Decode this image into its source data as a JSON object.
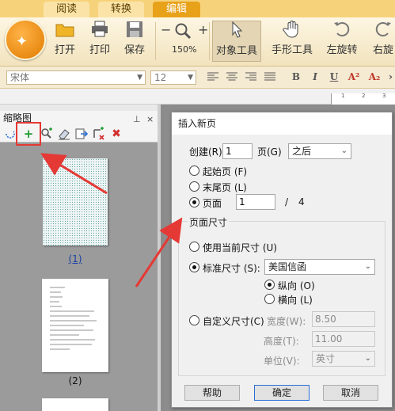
{
  "tabs": [
    {
      "label": "阅读",
      "active": false
    },
    {
      "label": "转换",
      "active": false
    },
    {
      "label": "编辑",
      "active": true
    }
  ],
  "ribbon": {
    "open_label": "打开",
    "print_label": "打印",
    "save_label": "保存",
    "zoom_value": "150%",
    "object_tool_label": "对象工具",
    "hand_tool_label": "手形工具",
    "rotate_left_label": "左旋转",
    "rotate_right_label": "右旋"
  },
  "format": {
    "font_name": "宋体",
    "font_size": "12",
    "bold": "B",
    "italic": "I",
    "underline": "U",
    "superscript": "A²",
    "subscript": "A₂"
  },
  "ruler": {
    "marks": [
      "1",
      "2",
      "3"
    ]
  },
  "thumbnail_panel": {
    "title": "缩略图",
    "pin_icon": "⊥",
    "close_icon": "×",
    "pages": [
      {
        "label": "(1)",
        "selected": true
      },
      {
        "label": "(2)",
        "selected": false
      }
    ]
  },
  "dialog": {
    "title": "插入新页",
    "create_label": "创建(R)",
    "create_value": "1",
    "page_unit_label": "页(G)",
    "position_value": "之后",
    "start_page_label": "起始页 (F)",
    "end_page_label": "末尾页 (L)",
    "page_label": "页面",
    "page_value": "1",
    "page_separator": "/",
    "page_total": "4",
    "size_group_title": "页面尺寸",
    "use_current_size_label": "使用当前尺寸 (U)",
    "standard_size_label": "标准尺寸 (S):",
    "standard_size_value": "美国信函",
    "portrait_label": "纵向 (O)",
    "landscape_label": "横向 (L)",
    "custom_size_label": "自定义尺寸(C)",
    "width_label": "宽度(W):",
    "width_value": "8.50",
    "height_label": "高度(T):",
    "height_value": "11.00",
    "unit_label": "单位(V):",
    "unit_value": "英寸",
    "help_button": "帮助",
    "ok_button": "确定",
    "cancel_button": "取消"
  },
  "colors": {
    "active_tab": "#e8a21a",
    "annotation": "#e53935",
    "default_button_border": "#2a6fd6"
  }
}
